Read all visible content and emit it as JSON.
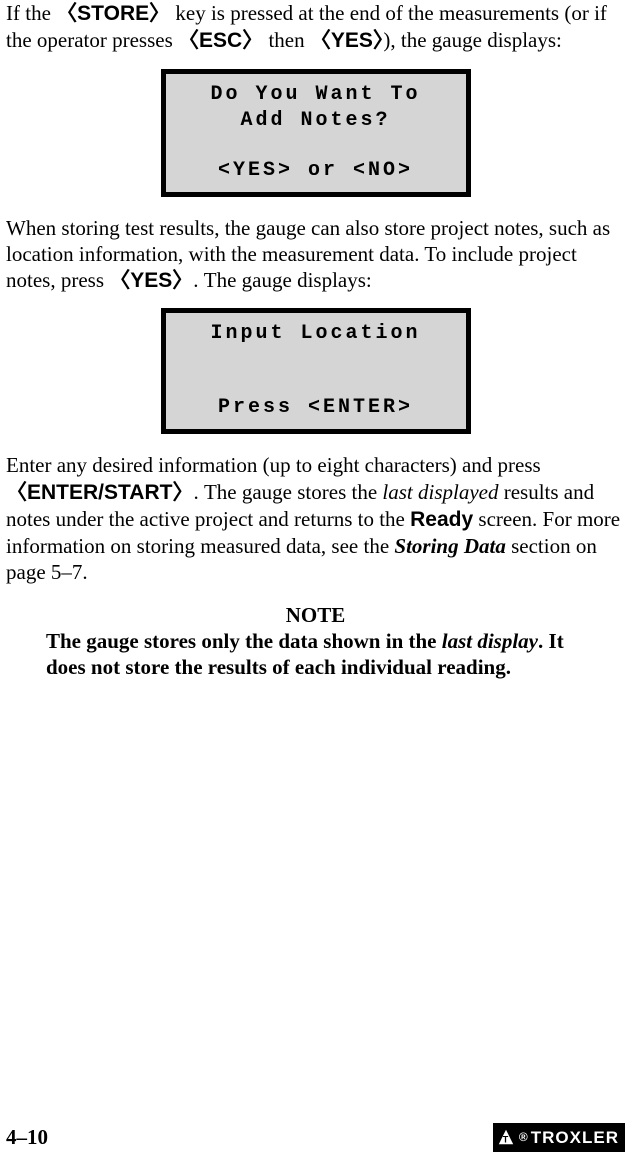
{
  "p1_a": "If the ",
  "p1_b": "STORE",
  "p1_c": " key is pressed at the end of the measurements (or if the operator presses ",
  "p1_d": "ESC",
  "p1_e": " then ",
  "p1_f": "YES",
  "p1_g": "), the gauge displays:",
  "screen1": {
    "l1": "Do You Want To",
    "l2": "Add Notes?",
    "l3": "<YES> or <NO>"
  },
  "p2_a": "When storing test results, the gauge can also store project notes, such as location information, with the measurement data. To include project notes, press ",
  "p2_b": "YES",
  "p2_c": ". The gauge displays:",
  "screen2": {
    "l1": "Input Location",
    "l2": "Press <ENTER>"
  },
  "p3_a": "Enter any desired information (up to eight characters) and press ",
  "p3_b": "ENTER/START",
  "p3_c": ". The gauge stores the ",
  "p3_d": "last displayed",
  "p3_e": " results and notes under the active project and returns to the ",
  "p3_f": "Ready",
  "p3_g": " screen. For more information on storing measured data, see the ",
  "p3_h": "Storing Data",
  "p3_i": " section on page 5–7.",
  "note_heading": "NOTE",
  "note_a": "The gauge stores only the data shown in the ",
  "note_b": "last display",
  "note_c": ". It does not store the results of each individual reading.",
  "page_number": "4–10",
  "logo_text": "TROXLER",
  "angle_l": "〈",
  "angle_r": "〉"
}
